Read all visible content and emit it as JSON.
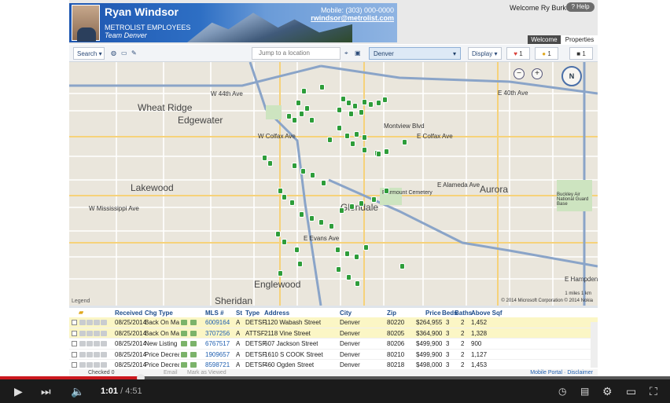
{
  "header": {
    "agent_name": "Ryan Windsor",
    "agent_org": "METROLIST EMPLOYEES",
    "agent_team": "Team Denver",
    "mobile": "Mobile: (303) 000-0000",
    "email": "rwindsor@metrolist.com",
    "welcome_text": "Welcome Ry Burke",
    "help_label": "Help",
    "tabs": [
      {
        "label": "Welcome"
      },
      {
        "label": "Properties"
      }
    ]
  },
  "toolbar": {
    "search_label": "Search",
    "locate_placeholder": "Jump to a location",
    "area_value": "Denver",
    "display_label": "Display",
    "favorites_count": "1",
    "ideas_count": "1",
    "rejects_count": "1"
  },
  "map": {
    "labels": {
      "wheat_ridge": "Wheat Ridge",
      "edgewater": "Edgewater",
      "lakewood": "Lakewood",
      "aurora": "Aurora",
      "englewood": "Englewood",
      "glendale": "Glendale",
      "sheridan": "Sheridan",
      "e_colfax": "E Colfax Ave",
      "w_colfax": "W Colfax Ave",
      "mississippi": "W Mississippi Ave",
      "alameda": "E Alameda Ave",
      "montview": "Montview Blvd",
      "fairmount": "Fairmount Cemetery",
      "buckley": "Buckley Air National Guard Base",
      "w_44th": "W 44th Ave",
      "e_40th": "E 40th Ave",
      "evans": "E Evans Ave",
      "hampden": "E Hampden Ave"
    },
    "compass_label": "N",
    "copyright": "© 2014 Microsoft Corporation  © 2014 Nokia",
    "scale": "1 miles     1 km",
    "legend_label": "Legend"
  },
  "list": {
    "columns": [
      "Received",
      "Chg Type",
      "MLS #",
      "St",
      "Type",
      "Address",
      "City",
      "Zip",
      "Price",
      "Beds",
      "Baths",
      "Above Sqf"
    ],
    "rows": [
      {
        "received": "08/25/2014",
        "chg": "Back On Mark",
        "mls": "6009164",
        "st": "A",
        "type": "DETSF",
        "address": "1120 Wabash Street",
        "city": "Denver",
        "zip": "80220",
        "price": "$264,955",
        "beds": "3",
        "baths": "2",
        "sqft": "1,452"
      },
      {
        "received": "08/25/2014",
        "chg": "Back On Mark",
        "mls": "3707256",
        "st": "A",
        "type": "ATTSF",
        "address": "2118 Vine Street",
        "city": "Denver",
        "zip": "80205",
        "price": "$364,900",
        "beds": "3",
        "baths": "2",
        "sqft": "1,328"
      },
      {
        "received": "08/25/2014",
        "chg": "New Listing",
        "mls": "6767517",
        "st": "A",
        "type": "DETSF",
        "address": "607 Jackson Street",
        "city": "Denver",
        "zip": "80206",
        "price": "$499,900",
        "beds": "3",
        "baths": "2",
        "sqft": "900"
      },
      {
        "received": "08/25/2014",
        "chg": "Price Decreas",
        "mls": "1909657",
        "st": "A",
        "type": "DETSF",
        "address": "1610 S COOK Street",
        "city": "Denver",
        "zip": "80210",
        "price": "$499,900",
        "beds": "3",
        "baths": "2",
        "sqft": "1,127"
      },
      {
        "received": "08/25/2014",
        "chg": "Price Decreas",
        "mls": "8598721",
        "st": "A",
        "type": "DETSF",
        "address": "460 Ogden Street",
        "city": "Denver",
        "zip": "80218",
        "price": "$498,000",
        "beds": "3",
        "baths": "2",
        "sqft": "1,453"
      }
    ],
    "footer": {
      "checked": "Checked 0",
      "email": "Email",
      "mark_viewed": "Mark as Viewed",
      "links": "Mobile Portal · Disclaimer"
    }
  },
  "player": {
    "current_time": "1:01",
    "duration": "/ 4:51",
    "progress": 0.21
  }
}
